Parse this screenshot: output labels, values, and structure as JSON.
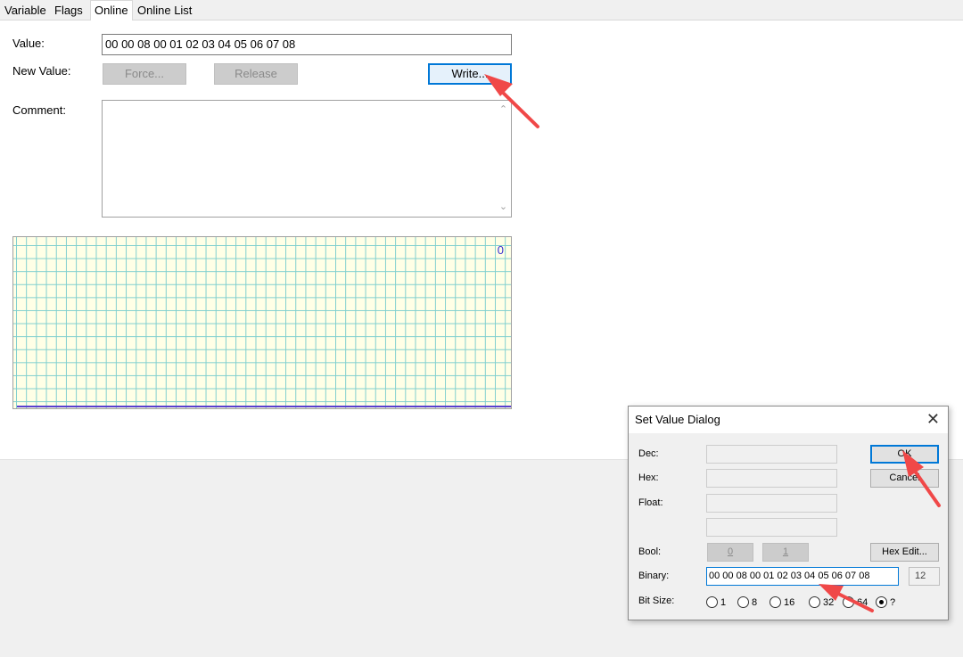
{
  "tabs": [
    {
      "label": "Variable",
      "active": false
    },
    {
      "label": "Flags",
      "active": false
    },
    {
      "label": "Online",
      "active": true
    },
    {
      "label": "Online List",
      "active": false
    }
  ],
  "online": {
    "value_label": "Value:",
    "value": "00 00 08 00 01 02 03 04 05 06 07 08",
    "new_value_label": "New Value:",
    "force_label": "Force...",
    "release_label": "Release",
    "write_label": "Write...",
    "comment_label": "Comment:",
    "comment": "",
    "graph_value": "0"
  },
  "dialog": {
    "title": "Set Value Dialog",
    "dec_label": "Dec:",
    "hex_label": "Hex:",
    "float_label": "Float:",
    "bool_label": "Bool:",
    "binary_label": "Binary:",
    "bitsize_label": "Bit Size:",
    "ok_label": "OK",
    "cancel_label": "Cancel",
    "hexedit_label": "Hex Edit...",
    "bool_false": "0",
    "bool_true": "1",
    "binary_value": "00 00 08 00 01 02 03 04 05 06 07 08",
    "binary_count": "12",
    "bitsizes": [
      "1",
      "8",
      "16",
      "32",
      "64",
      "?"
    ],
    "bitsize_selected": "?"
  },
  "colors": {
    "accent": "#0078d7",
    "annotation_arrow": "#f04848",
    "graph_background": "#ffffe6",
    "graph_grid": "#7fcfcf",
    "graph_line": "#5a3fcf"
  }
}
